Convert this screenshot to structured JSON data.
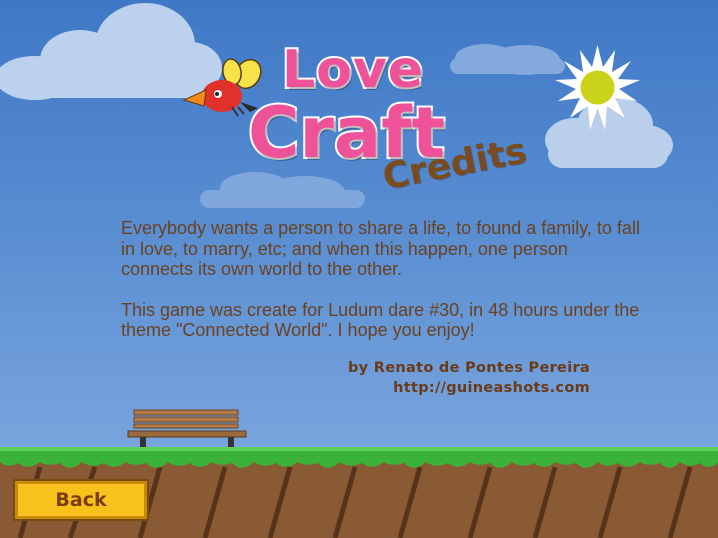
{
  "logo": {
    "line1": "Love",
    "line2": "Craft",
    "subtitle": "Credits"
  },
  "story": {
    "paragraph1": "Everybody wants a person to share a life, to found a family, to fall in love, to marry, etc; and when this happen, one person connects its own world to the other.",
    "paragraph2": "This game was create for Ludum dare #30, in 48 hours under the theme \"Connected World\". I hope you enjoy!"
  },
  "credits": {
    "author": "by Renato de Pontes Pereira",
    "website": "http://guineashots.com"
  },
  "buttons": {
    "back_label": "Back"
  },
  "colors": {
    "sky_top": "#3f78c6",
    "sky_bottom": "#86aee2",
    "logo_pink": "#f0529a",
    "text_brown": "#6b4221",
    "button_yellow": "#f6c21b",
    "grass_green": "#3bb23a",
    "dirt_brown": "#8a5a35"
  },
  "icons": [
    "sun-icon",
    "bird-icon",
    "heart-icon",
    "bench-icon"
  ]
}
